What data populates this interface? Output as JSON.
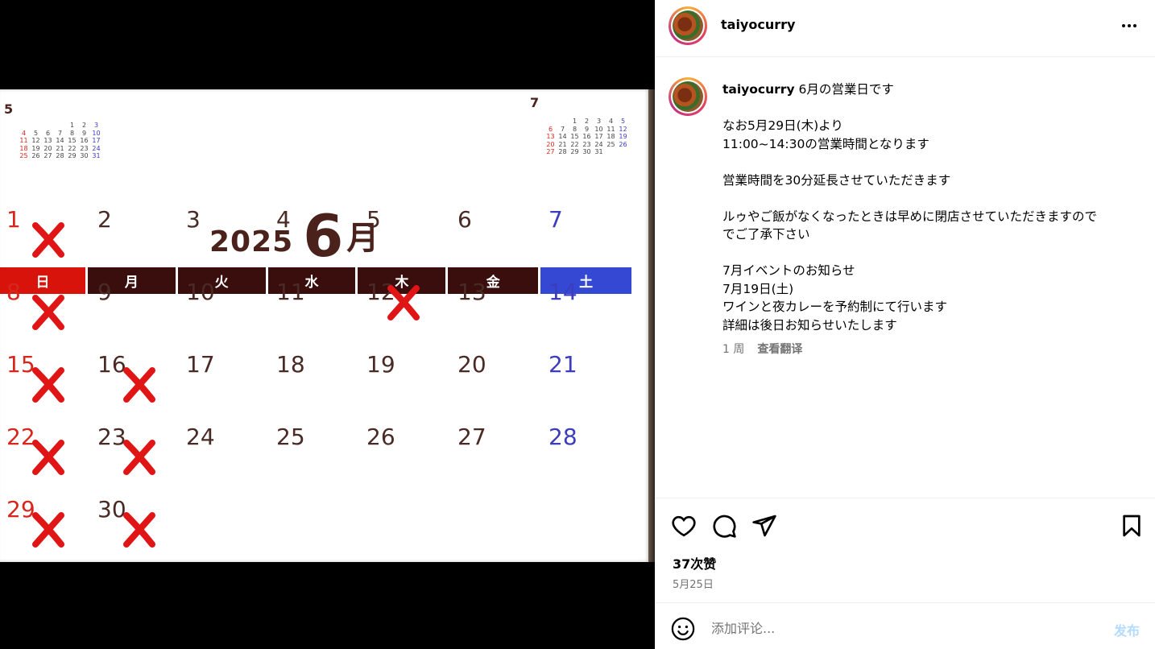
{
  "calendar": {
    "year": "2025",
    "month_num": "6",
    "month_kanji": "月",
    "weekdays": [
      "日",
      "月",
      "火",
      "水",
      "木",
      "金",
      "土"
    ],
    "weekday_colors": [
      "#d8130c",
      "#3a0e0c",
      "#3a0e0c",
      "#3a0e0c",
      "#3a0e0c",
      "#3a0e0c",
      "#3448d4"
    ],
    "prev_mini": {
      "month": "5",
      "rows": [
        [
          "",
          "",
          "",
          "",
          "1",
          "2",
          "3"
        ],
        [
          "4",
          "5",
          "6",
          "7",
          "8",
          "9",
          "10"
        ],
        [
          "11",
          "12",
          "13",
          "14",
          "15",
          "16",
          "17"
        ],
        [
          "18",
          "19",
          "20",
          "21",
          "22",
          "23",
          "24"
        ],
        [
          "25",
          "26",
          "27",
          "28",
          "29",
          "30",
          "31"
        ]
      ]
    },
    "next_mini": {
      "month": "7",
      "rows": [
        [
          "",
          "",
          "1",
          "2",
          "3",
          "4",
          "5"
        ],
        [
          "6",
          "7",
          "8",
          "9",
          "10",
          "11",
          "12"
        ],
        [
          "13",
          "14",
          "15",
          "16",
          "17",
          "18",
          "19"
        ],
        [
          "20",
          "21",
          "22",
          "23",
          "24",
          "25",
          "26"
        ],
        [
          "27",
          "28",
          "29",
          "30",
          "31",
          "",
          ""
        ]
      ]
    },
    "weeks": [
      [
        "1",
        "2",
        "3",
        "4",
        "5",
        "6",
        "7"
      ],
      [
        "8",
        "9",
        "10",
        "11",
        "12",
        "13",
        "14"
      ],
      [
        "15",
        "16",
        "17",
        "18",
        "19",
        "20",
        "21"
      ],
      [
        "22",
        "23",
        "24",
        "25",
        "26",
        "27",
        "28"
      ],
      [
        "29",
        "30",
        "",
        "",
        "",
        "",
        ""
      ]
    ],
    "closed_days": [
      "1",
      "8",
      "12",
      "15",
      "16",
      "22",
      "23",
      "29",
      "30"
    ],
    "mark_color": "#e01515"
  },
  "post": {
    "username": "taiyocurry",
    "caption_lines": [
      "6月の営業日です",
      "",
      "なお5月29日(木)より",
      "11:00~14:30の営業時間となります",
      "",
      "営業時間を30分延長させていただきます",
      "",
      "ルゥやご飯がなくなったときは早めに閉店させていただきますので",
      "でご了承下さい",
      "",
      "7月イベントのお知らせ",
      "7月19日(土)",
      "ワインと夜カレーを予約制にて行います",
      "詳細は後日お知らせいたします"
    ],
    "time_ago": "1 周",
    "translate_label": "查看翻译",
    "likes": "37次赞",
    "date": "5月25日",
    "comment_placeholder": "添加评论...",
    "post_button": "发布"
  },
  "colors": {
    "link_blue_disabled": "#b3dbff",
    "meta_gray": "#737373",
    "divider": "#efefef"
  }
}
